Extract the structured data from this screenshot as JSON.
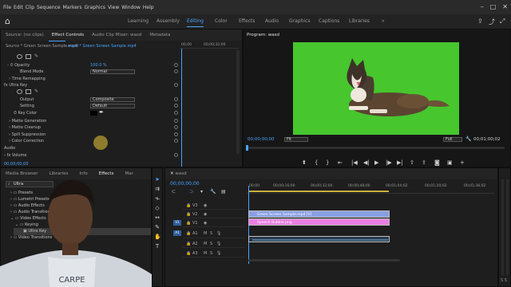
{
  "menu": [
    "File",
    "Edit",
    "Clip",
    "Sequence",
    "Markers",
    "Graphics",
    "View",
    "Window",
    "Help"
  ],
  "workspaces": [
    {
      "label": "Learning",
      "active": false
    },
    {
      "label": "Assembly",
      "active": false
    },
    {
      "label": "Editing",
      "active": true
    },
    {
      "label": "Color",
      "active": false
    },
    {
      "label": "Effects",
      "active": false
    },
    {
      "label": "Audio",
      "active": false
    },
    {
      "label": "Graphics",
      "active": false
    },
    {
      "label": "Captions",
      "active": false
    },
    {
      "label": "Libraries",
      "active": false
    }
  ],
  "source_panel": {
    "tabs": [
      "Source: (no clips)",
      "Effect Controls",
      "Audio Clip Mixer: wasd",
      "Metadata"
    ],
    "active_tab": "Effect Controls",
    "master_label": "Source * Green Screen Sample.mp4",
    "clip_label": "wasd * Green Screen Sample.mp4",
    "timecode": "00;00;00;00"
  },
  "effect_controls": {
    "rows": [
      {
        "label": "Opacity",
        "value": "100.0 %",
        "value_type": "blue"
      },
      {
        "label": "Blend Mode",
        "value": "Normal",
        "value_type": "drop"
      },
      {
        "label": "Time Remapping",
        "value": "",
        "value_type": ""
      },
      {
        "label": "Ultra Key",
        "value": "",
        "value_type": ""
      },
      {
        "label": "Output",
        "value": "Composite",
        "value_type": "drop"
      },
      {
        "label": "Setting",
        "value": "Default",
        "value_type": "drop"
      },
      {
        "label": "Key Color",
        "value": "",
        "value_type": ""
      },
      {
        "label": "Matte Generation",
        "value": "",
        "value_type": ""
      },
      {
        "label": "Matte Cleanup",
        "value": "",
        "value_type": ""
      },
      {
        "label": "Spill Suppression",
        "value": "",
        "value_type": ""
      },
      {
        "label": "Color Correction",
        "value": "",
        "value_type": ""
      },
      {
        "label": "Audio",
        "value": "",
        "value_type": ""
      },
      {
        "label": "Volume",
        "value": "",
        "value_type": ""
      }
    ]
  },
  "program_monitor": {
    "title": "Program: wasd",
    "timecode_left": "00;00;00;00",
    "fit": "Fit",
    "quality": "Full",
    "timecode_right": "00;01;00;02"
  },
  "project_panel": {
    "tabs": [
      "Media Browser",
      "Libraries",
      "Info",
      "Effects",
      "Mar"
    ],
    "active_tab": "Effects",
    "search_value": "Ultra",
    "items": [
      {
        "label": "Presets",
        "indent": 0
      },
      {
        "label": "Lumetri Presets",
        "indent": 0
      },
      {
        "label": "Audio Effects",
        "indent": 0
      },
      {
        "label": "Audio Transitions",
        "indent": 0
      },
      {
        "label": "Video Effects",
        "indent": 0
      },
      {
        "label": "Keying",
        "indent": 1
      },
      {
        "label": "Ultra Key",
        "indent": 2
      },
      {
        "label": "Video Transitions",
        "indent": 0
      }
    ]
  },
  "timeline": {
    "sequence_name": "wasd",
    "timecode": "00;00;00;00",
    "ruler": [
      "00;00",
      "00;00;16;00",
      "00;00;32;00",
      "00;00;48;00",
      "00;01;04;02",
      "00;01;20;02",
      "00;01;36;02"
    ],
    "tracks": [
      "V3",
      "V2",
      "V1",
      "A1",
      "A2",
      "A3"
    ],
    "clips": [
      {
        "label": "Green Screen Sample.mp4 [V]",
        "track": "V2",
        "color": "#8aa0e6"
      },
      {
        "label": "Speech Bubble.png",
        "track": "V1",
        "color": "#e97fe2"
      }
    ]
  },
  "accent": "#4aa3ff"
}
